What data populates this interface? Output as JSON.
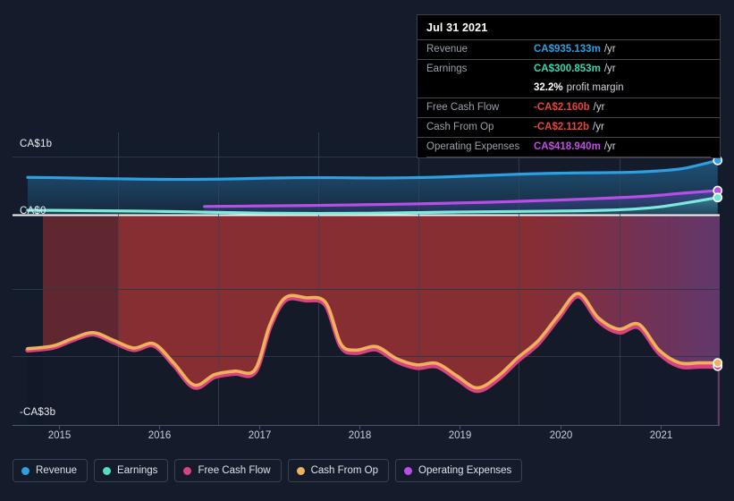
{
  "tooltip": {
    "date": "Jul 31 2021",
    "rows": [
      {
        "label": "Revenue",
        "value": "CA$935.133m",
        "unit": "/yr",
        "color": "#2e9fe0"
      },
      {
        "label": "Earnings",
        "value": "CA$300.853m",
        "unit": "/yr",
        "color": "#38d6b0"
      },
      {
        "label": "Free Cash Flow",
        "value": "-CA$2.160b",
        "unit": "/yr",
        "color": "#e8453c"
      },
      {
        "label": "Cash From Op",
        "value": "-CA$2.112b",
        "unit": "/yr",
        "color": "#e8453c"
      },
      {
        "label": "Operating Expenses",
        "value": "CA$418.940m",
        "unit": "/yr",
        "color": "#c44ce8"
      }
    ],
    "margin": {
      "value": "32.2%",
      "label": "profit margin",
      "color": "#ffffff"
    }
  },
  "axes": {
    "y_labels": {
      "top": "CA$1b",
      "zero": "CA$0",
      "bottom": "-CA$3b"
    },
    "x_ticks": [
      "2015",
      "2016",
      "2017",
      "2018",
      "2019",
      "2020",
      "2021"
    ]
  },
  "legend": [
    {
      "label": "Revenue",
      "color": "#2e9fe0",
      "name": "legend-item-revenue"
    },
    {
      "label": "Earnings",
      "color": "#4fe0c0",
      "name": "legend-item-earnings"
    },
    {
      "label": "Free Cash Flow",
      "color": "#d8437f",
      "name": "legend-item-free-cash-flow"
    },
    {
      "label": "Cash From Op",
      "color": "#efb15b",
      "name": "legend-item-cash-from-op"
    },
    {
      "label": "Operating Expenses",
      "color": "#b94de8",
      "name": "legend-item-operating-expenses"
    }
  ],
  "chart_data": {
    "type": "line",
    "title": "",
    "xlabel": "",
    "ylabel": "CA$",
    "ylim": [
      -3000,
      1000
    ],
    "y_unit": "millions CAD",
    "xlim": [
      2014.6,
      2021.6
    ],
    "grid": true,
    "gridline_values": [
      1000,
      0,
      -1100,
      -2100,
      -3000
    ],
    "legend_position": "bottom",
    "highlight_marker_date": "Jul 31 2021",
    "series": [
      {
        "name": "Revenue",
        "color": "#2e9fe0",
        "x": [
          2014.75,
          2015.0,
          2015.25,
          2015.5,
          2015.75,
          2016.0,
          2016.25,
          2016.5,
          2016.75,
          2017.0,
          2017.25,
          2017.5,
          2017.75,
          2018.0,
          2018.25,
          2018.5,
          2018.75,
          2019.0,
          2019.25,
          2019.5,
          2019.75,
          2020.0,
          2020.25,
          2020.5,
          2020.75,
          2021.0,
          2021.25,
          2021.58
        ],
        "values": [
          645,
          640,
          632,
          624,
          618,
          612,
          610,
          612,
          618,
          628,
          636,
          640,
          640,
          636,
          634,
          638,
          646,
          660,
          676,
          692,
          706,
          716,
          722,
          726,
          734,
          756,
          800,
          935
        ]
      },
      {
        "name": "Earnings",
        "color": "#4fe0c0",
        "x": [
          2014.75,
          2015.0,
          2015.25,
          2015.5,
          2015.75,
          2016.0,
          2016.25,
          2016.5,
          2016.75,
          2017.0,
          2017.25,
          2017.5,
          2017.75,
          2018.0,
          2018.25,
          2018.5,
          2018.75,
          2019.0,
          2019.25,
          2019.5,
          2019.75,
          2020.0,
          2020.25,
          2020.5,
          2020.75,
          2021.0,
          2021.25,
          2021.58
        ],
        "values": [
          85,
          82,
          78,
          74,
          70,
          66,
          60,
          52,
          44,
          36,
          32,
          30,
          30,
          32,
          36,
          42,
          48,
          54,
          58,
          62,
          66,
          70,
          76,
          86,
          104,
          140,
          205,
          301
        ]
      },
      {
        "name": "Operating Expenses",
        "color": "#b94de8",
        "x": [
          2016.5,
          2016.75,
          2017.0,
          2017.25,
          2017.5,
          2017.75,
          2018.0,
          2018.25,
          2018.5,
          2018.75,
          2019.0,
          2019.25,
          2019.5,
          2019.75,
          2020.0,
          2020.25,
          2020.5,
          2020.75,
          2021.0,
          2021.25,
          2021.58
        ],
        "values": [
          148,
          152,
          156,
          160,
          164,
          170,
          176,
          182,
          190,
          198,
          208,
          218,
          230,
          244,
          258,
          274,
          292,
          312,
          340,
          378,
          419
        ]
      },
      {
        "name": "Cash From Op",
        "color": "#efb15b",
        "x": [
          2014.75,
          2015.0,
          2015.2,
          2015.4,
          2015.6,
          2015.8,
          2016.0,
          2016.2,
          2016.4,
          2016.6,
          2016.8,
          2017.0,
          2017.15,
          2017.3,
          2017.5,
          2017.7,
          2017.85,
          2018.0,
          2018.2,
          2018.4,
          2018.6,
          2018.8,
          2019.0,
          2019.2,
          2019.4,
          2019.6,
          2019.8,
          2020.0,
          2020.2,
          2020.4,
          2020.6,
          2020.8,
          2021.0,
          2021.2,
          2021.4,
          2021.58
        ],
        "values": [
          -1910,
          -1870,
          -1760,
          -1680,
          -1790,
          -1900,
          -1840,
          -2120,
          -2430,
          -2280,
          -2230,
          -2210,
          -1560,
          -1180,
          -1180,
          -1250,
          -1840,
          -1930,
          -1880,
          -2050,
          -2140,
          -2120,
          -2300,
          -2470,
          -2310,
          -2040,
          -1800,
          -1440,
          -1120,
          -1470,
          -1630,
          -1560,
          -1930,
          -2110,
          -2112,
          -2112
        ]
      },
      {
        "name": "Free Cash Flow",
        "color": "#d8437f",
        "x": [
          2014.75,
          2015.0,
          2015.2,
          2015.4,
          2015.6,
          2015.8,
          2016.0,
          2016.2,
          2016.4,
          2016.6,
          2016.8,
          2017.0,
          2017.15,
          2017.3,
          2017.5,
          2017.7,
          2017.85,
          2018.0,
          2018.2,
          2018.4,
          2018.6,
          2018.8,
          2019.0,
          2019.2,
          2019.4,
          2019.6,
          2019.8,
          2020.0,
          2020.2,
          2020.4,
          2020.6,
          2020.8,
          2021.0,
          2021.2,
          2021.4,
          2021.58
        ],
        "values": [
          -1930,
          -1890,
          -1780,
          -1700,
          -1812,
          -1922,
          -1862,
          -2145,
          -2460,
          -2310,
          -2262,
          -2242,
          -1590,
          -1212,
          -1212,
          -1282,
          -1872,
          -1965,
          -1915,
          -2085,
          -2178,
          -2158,
          -2338,
          -2508,
          -2348,
          -2078,
          -1838,
          -1475,
          -1155,
          -1508,
          -1672,
          -1600,
          -1968,
          -2155,
          -2160,
          -2160
        ]
      }
    ]
  }
}
